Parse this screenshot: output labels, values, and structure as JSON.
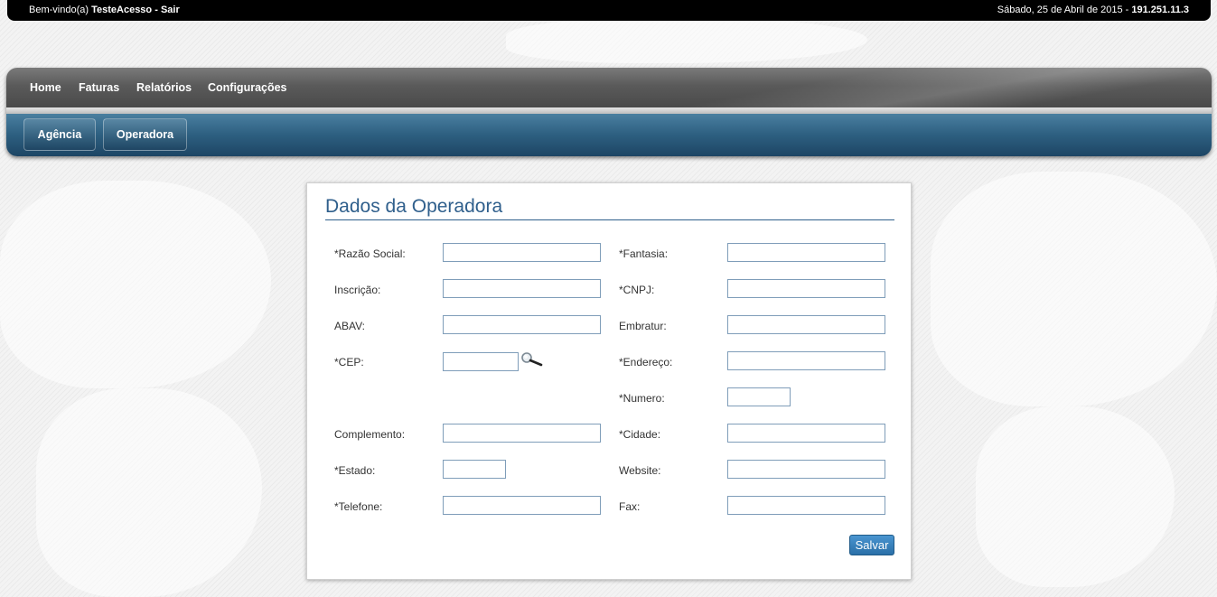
{
  "topbar": {
    "welcome_prefix": "Bem-vindo(a)",
    "username": "TesteAcesso",
    "separator": "-",
    "logout": "Sair",
    "date": "Sábado, 25 de Abril de 2015 -",
    "ip": "191.251.11.3"
  },
  "menu": {
    "items": [
      "Home",
      "Faturas",
      "Relatórios",
      "Configurações"
    ]
  },
  "submenu": {
    "items": [
      "Agência",
      "Operadora"
    ]
  },
  "form": {
    "title": "Dados da Operadora",
    "labels": {
      "razao_social": "*Razão Social:",
      "fantasia": "*Fantasia:",
      "inscricao": "Inscrição:",
      "cnpj": "*CNPJ:",
      "abav": "ABAV:",
      "embratur": "Embratur:",
      "cep": "*CEP:",
      "endereco": "*Endereço:",
      "numero": "*Numero:",
      "complemento": "Complemento:",
      "cidade": "*Cidade:",
      "estado": "*Estado:",
      "website": "Website:",
      "telefone": "*Telefone:",
      "fax": "Fax:"
    },
    "values": {
      "razao_social": "",
      "fantasia": "",
      "inscricao": "",
      "cnpj": "",
      "abav": "",
      "embratur": "",
      "cep": "",
      "endereco": "",
      "numero": "",
      "complemento": "",
      "cidade": "",
      "estado": "",
      "website": "",
      "telefone": "",
      "fax": ""
    },
    "save_label": "Salvar"
  },
  "colors": {
    "title": "#2f5f8c",
    "submenu_bg": "#2d5f80",
    "menu_bg": "#5a5a5a",
    "save_button": "#3a82bf"
  },
  "icons": {
    "cep_search": "magnifier-icon"
  }
}
